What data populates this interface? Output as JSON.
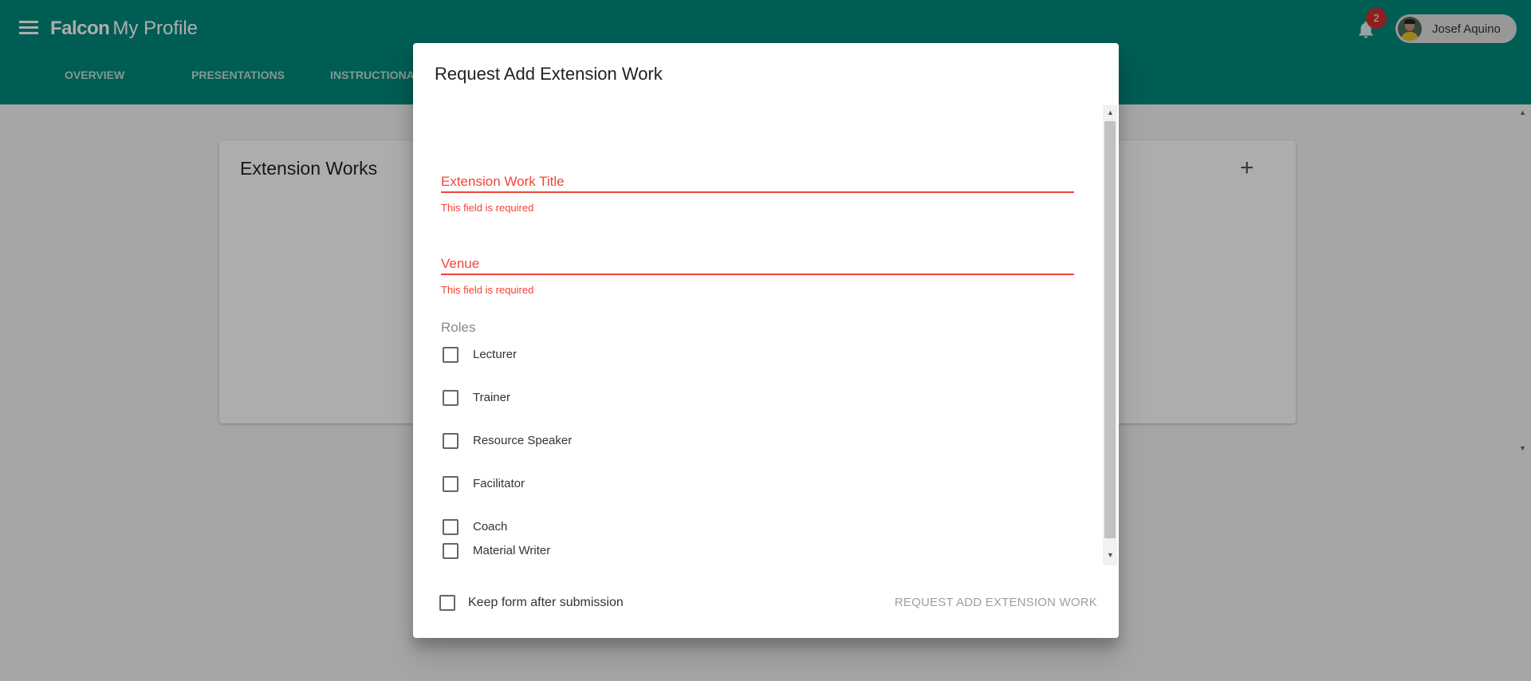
{
  "header": {
    "brand": "Falcon",
    "page": "My Profile",
    "notification_count": "2",
    "user_name": "Josef Aquino"
  },
  "tabs": [
    "OVERVIEW",
    "PRESENTATIONS",
    "INSTRUCTIONA"
  ],
  "card": {
    "title": "Extension Works"
  },
  "dialog": {
    "title": "Request Add Extension Work",
    "fields": [
      {
        "label": "Extension Work Title",
        "error": "This field is required"
      },
      {
        "label": "Venue",
        "error": "This field is required"
      }
    ],
    "roles_label": "Roles",
    "roles": [
      "Lecturer",
      "Trainer",
      "Resource Speaker",
      "Facilitator",
      "Coach",
      "Material Writer"
    ],
    "keep_form_label": "Keep form after submission",
    "submit_label": "REQUEST ADD EXTENSION WORK"
  },
  "colors": {
    "primary": "#00897b",
    "error": "#f44336",
    "badge": "#d32f2f"
  }
}
